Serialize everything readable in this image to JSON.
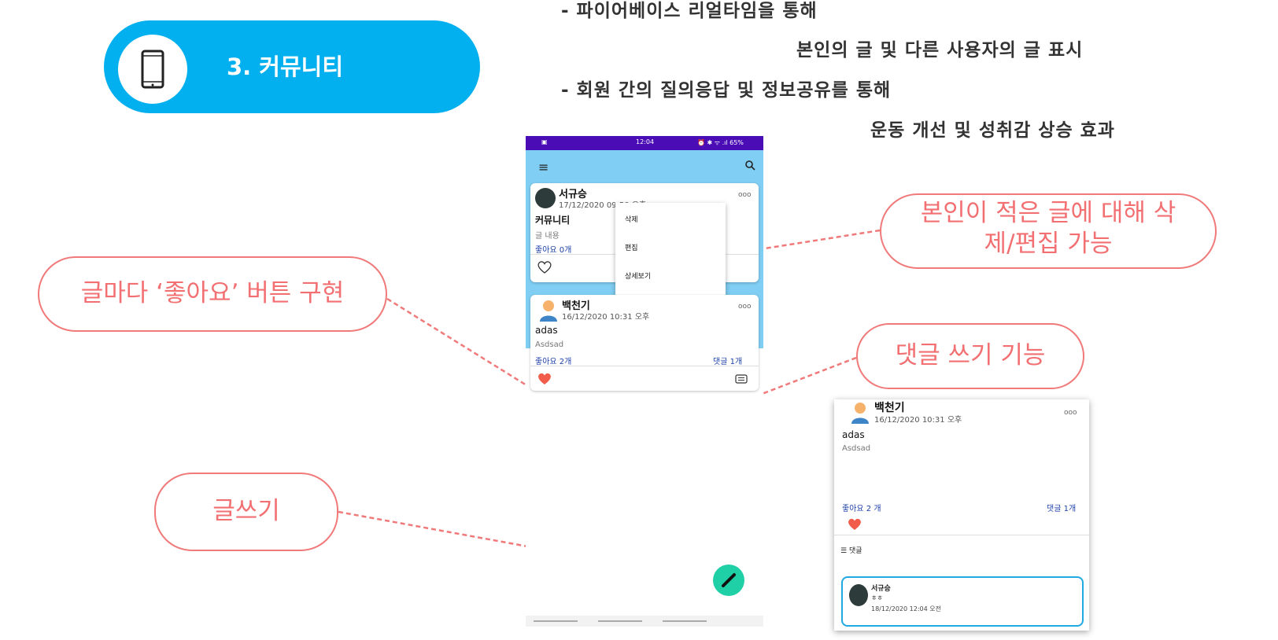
{
  "section": {
    "title": "3. 커뮤니티",
    "icon": "smartphone-icon"
  },
  "description": {
    "line1": "- 파이어베이스 리얼타임을 통해",
    "line2": "본인의 글 및 다른 사용자의 글 표시",
    "line3": "- 회원 간의 질의응답 및 정보공유를 통해",
    "line4": "운동 개선 및 성취감 상승 효과"
  },
  "callouts": {
    "edit_delete": "본인이 적은 글에 대해 삭제/편집 가능",
    "like": "글마다 ‘좋아요’ 버튼 구현",
    "comment": "댓글 쓰기 기능",
    "write": "글쓰기"
  },
  "phone": {
    "status_time": "12:04",
    "status_right": "⏰ ✱ ᯤ .ıl 65%",
    "posts": [
      {
        "author": "서규승",
        "date": "17/12/2020 09:50 오후",
        "title": "커뮤니티",
        "body": "글 내용",
        "likes": "좋아요 0개",
        "more": "ooo"
      },
      {
        "author": "백천기",
        "date": "16/12/2020 10:31 오후",
        "title": "adas",
        "body": "Asdsad",
        "likes": "좋아요 2개",
        "comments": "댓글 1개",
        "more": "ooo"
      }
    ],
    "menu": [
      "삭제",
      "편집",
      "상세보기"
    ]
  },
  "detail": {
    "author": "백천기",
    "date": "16/12/2020 10:31 오후",
    "title": "adas",
    "body": "Asdsad",
    "likes": "좋아요 2 개",
    "comments": "댓글 1개",
    "comment_header": "댓글",
    "more": "ooo",
    "comment": {
      "author": "서규승",
      "text": "ㅎㅎ",
      "date": "18/12/2020 12:04 오전"
    }
  },
  "colors": {
    "accent": "#03b0ef",
    "callout": "#f0797a",
    "status_bar": "#4a0db5",
    "app_bar": "#80cef3",
    "fab": "#1fcfa6",
    "heart": "#f25c4a"
  }
}
